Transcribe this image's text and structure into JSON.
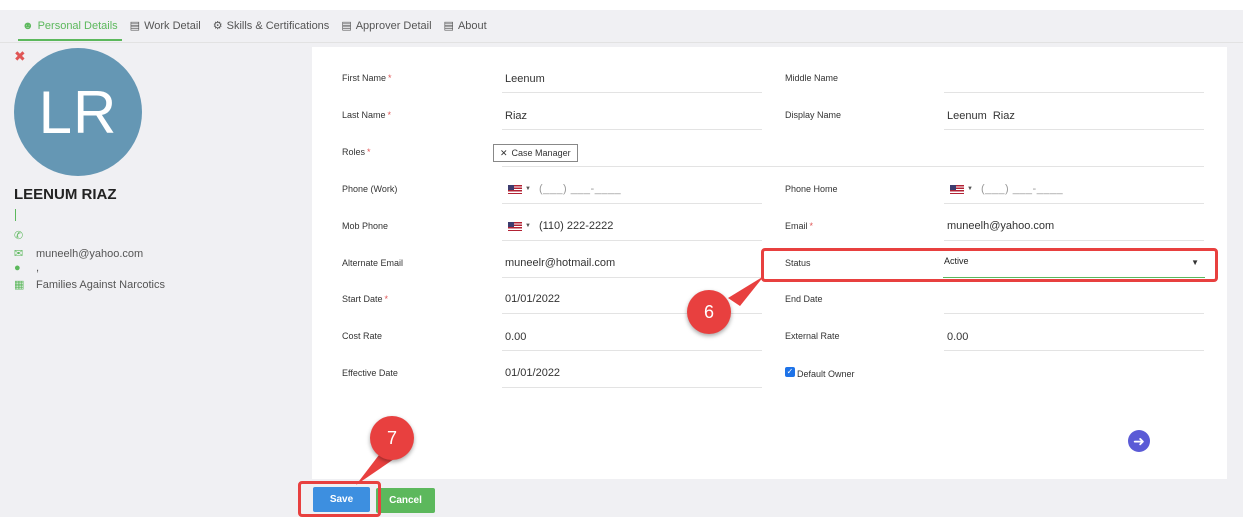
{
  "tabs": [
    {
      "label": "Personal Details",
      "icon": "person-icon",
      "active": true
    },
    {
      "label": "Work Detail",
      "icon": "card-icon"
    },
    {
      "label": "Skills & Certifications",
      "icon": "gears-icon"
    },
    {
      "label": "Approver Detail",
      "icon": "card-icon"
    },
    {
      "label": "About",
      "icon": "card-icon"
    }
  ],
  "profile": {
    "initials": "LR",
    "name": "LEENUM RIAZ",
    "email": "muneelh@yahoo.com",
    "location": ",",
    "organization": "Families Against Narcotics",
    "avatar_color": "#6597b4"
  },
  "form": {
    "first_name": {
      "label": "First Name",
      "value": "Leenum"
    },
    "middle_name": {
      "label": "Middle Name",
      "value": ""
    },
    "last_name": {
      "label": "Last Name",
      "value": "Riaz"
    },
    "display_name": {
      "label": "Display Name",
      "value": "Leenum  Riaz"
    },
    "roles": {
      "label": "Roles",
      "tags": [
        "Case Manager"
      ]
    },
    "phone_work": {
      "label": "Phone (Work)",
      "placeholder": "(___) ___-____"
    },
    "phone_home": {
      "label": "Phone Home",
      "placeholder": "(___) ___-____"
    },
    "mob_phone": {
      "label": "Mob Phone",
      "value": "(110) 222-2222"
    },
    "email": {
      "label": "Email",
      "value": "muneelh@yahoo.com"
    },
    "alternate_email": {
      "label": "Alternate Email",
      "value": "muneelr@hotmail.com"
    },
    "status": {
      "label": "Status",
      "value": "Active"
    },
    "start_date": {
      "label": "Start Date",
      "value": "01/01/2022"
    },
    "end_date": {
      "label": "End Date",
      "value": ""
    },
    "cost_rate": {
      "label": "Cost Rate",
      "value": "0.00"
    },
    "external_rate": {
      "label": "External Rate",
      "value": "0.00"
    },
    "effective_date": {
      "label": "Effective Date",
      "value": "01/01/2022"
    },
    "default_owner": {
      "label": "Default Owner",
      "checked": true
    },
    "required_mark": "*"
  },
  "callouts": {
    "status_step": "6",
    "save_step": "7"
  },
  "buttons": {
    "save": "Save",
    "cancel": "Cancel"
  },
  "colors": {
    "accent_green": "#5cb85c",
    "callout_red": "#e8403f",
    "save_blue": "#3d8fe0"
  }
}
